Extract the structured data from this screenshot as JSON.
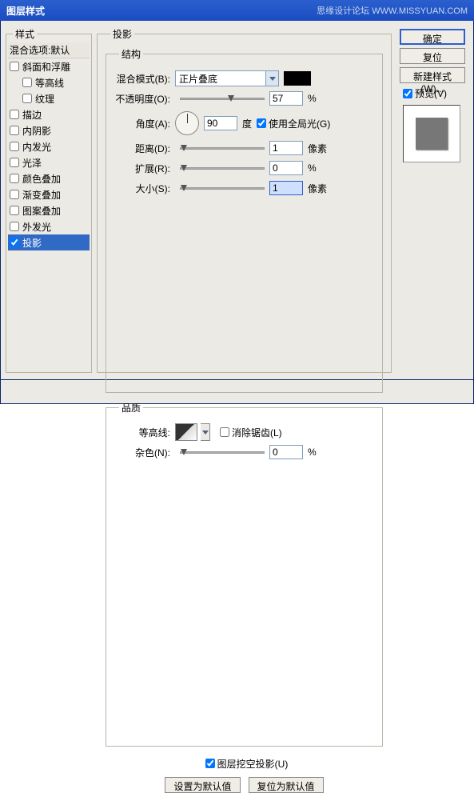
{
  "window": {
    "title": "图层样式",
    "credit": "思缘设计论坛  WWW.MISSYUAN.COM"
  },
  "left": {
    "legend": "样式",
    "header": "混合选项:默认",
    "items": [
      {
        "label": "斜面和浮雕",
        "checked": false,
        "indent": false
      },
      {
        "label": "等高线",
        "checked": false,
        "indent": true
      },
      {
        "label": "纹理",
        "checked": false,
        "indent": true
      },
      {
        "label": "描边",
        "checked": false,
        "indent": false
      },
      {
        "label": "内阴影",
        "checked": false,
        "indent": false
      },
      {
        "label": "内发光",
        "checked": false,
        "indent": false
      },
      {
        "label": "光泽",
        "checked": false,
        "indent": false
      },
      {
        "label": "颜色叠加",
        "checked": false,
        "indent": false
      },
      {
        "label": "渐变叠加",
        "checked": false,
        "indent": false
      },
      {
        "label": "图案叠加",
        "checked": false,
        "indent": false
      },
      {
        "label": "外发光",
        "checked": false,
        "indent": false
      },
      {
        "label": "投影",
        "checked": true,
        "indent": false,
        "selected": true
      }
    ]
  },
  "center": {
    "legend": "投影",
    "structure": {
      "legend": "结构",
      "blend_label": "混合模式(B):",
      "blend_value": "正片叠底",
      "color": "#000000",
      "opacity_label": "不透明度(O):",
      "opacity_value": "57",
      "opacity_unit": "%",
      "angle_label": "角度(A):",
      "angle_value": "90",
      "angle_unit": "度",
      "global_light": "使用全局光(G)",
      "distance_label": "距离(D):",
      "distance_value": "1",
      "distance_unit": "像素",
      "spread_label": "扩展(R):",
      "spread_value": "0",
      "spread_unit": "%",
      "size_label": "大小(S):",
      "size_value": "1",
      "size_unit": "像素"
    },
    "quality": {
      "legend": "品质",
      "contour_label": "等高线:",
      "antialias": "消除锯齿(L)",
      "noise_label": "杂色(N):",
      "noise_value": "0",
      "noise_unit": "%"
    },
    "knockout": "图层挖空投影(U)",
    "make_default": "设置为默认值",
    "reset_default": "复位为默认值"
  },
  "right": {
    "ok": "确定",
    "reset": "复位",
    "new_style": "新建样式(W)...",
    "preview": "预览(V)"
  }
}
